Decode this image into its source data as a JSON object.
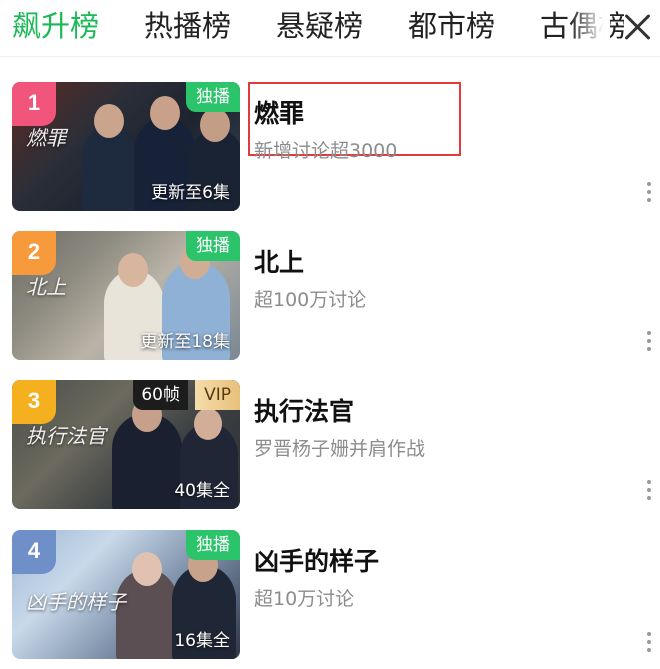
{
  "tabs": [
    {
      "label": "飙升榜",
      "active": true
    },
    {
      "label": "热播榜",
      "active": false
    },
    {
      "label": "悬疑榜",
      "active": false
    },
    {
      "label": "都市榜",
      "active": false
    },
    {
      "label": "古偶榜",
      "active": false
    }
  ],
  "colors": {
    "accent": "#19b955",
    "highlight": "#e23a3a"
  },
  "items": [
    {
      "rank": "1",
      "rank_color": "#f2557c",
      "title": "燃罪",
      "subtitle": "新增讨论超3000",
      "badge": "独播",
      "episodes": "更新至6集",
      "logo_text": "燃罪"
    },
    {
      "rank": "2",
      "rank_color": "#f79a3c",
      "title": "北上",
      "subtitle": "超100万讨论",
      "badge": "独播",
      "episodes": "更新至18集",
      "logo_text": "北上"
    },
    {
      "rank": "3",
      "rank_color": "#f5b020",
      "title": "执行法官",
      "subtitle": "罗晋杨子姗并肩作战",
      "fps": "60帧",
      "vip": "VIP",
      "episodes": "40集全",
      "logo_text": "执行法官"
    },
    {
      "rank": "4",
      "rank_color": "#6f8fc9",
      "title": "凶手的样子",
      "subtitle": "超10万讨论",
      "badge": "独播",
      "episodes": "16集全",
      "logo_text": "凶手的样子"
    }
  ]
}
